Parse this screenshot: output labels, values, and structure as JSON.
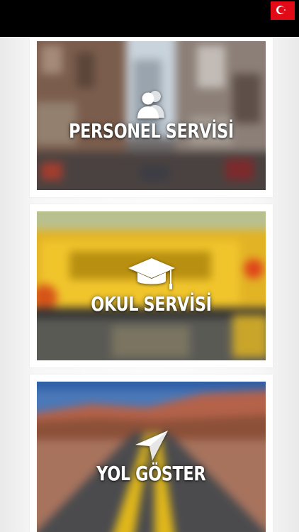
{
  "header": {
    "language_flag_icon": "turkish-flag-icon",
    "flag_color": "#e30a17"
  },
  "cards": [
    {
      "label": "PERSONEL SERVİSİ",
      "icon": "people-icon"
    },
    {
      "label": "OKUL SERVİSİ",
      "icon": "graduation-cap-icon"
    },
    {
      "label": "YOL GÖSTER",
      "icon": "navigation-arrow-icon"
    }
  ]
}
